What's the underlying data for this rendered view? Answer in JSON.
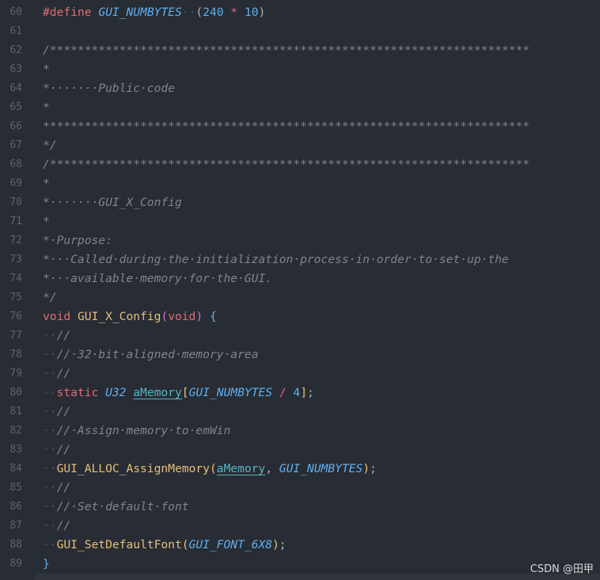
{
  "watermark": "CSDN @田甲",
  "lines": [
    {
      "n": "60",
      "parts": [
        [
          "kw",
          "#define"
        ],
        [
          "ws",
          " "
        ],
        [
          "cst",
          "GUI_NUMBYTES"
        ],
        [
          "ws",
          "··"
        ],
        [
          "code",
          "("
        ],
        [
          "num",
          "240"
        ],
        [
          "ws",
          " "
        ],
        [
          "op",
          "*"
        ],
        [
          "ws",
          " "
        ],
        [
          "num",
          "10"
        ],
        [
          "code",
          ")"
        ]
      ]
    },
    {
      "n": "61",
      "parts": []
    },
    {
      "n": "62",
      "parts": [
        [
          "cm",
          "/*********************************************************************"
        ]
      ]
    },
    {
      "n": "63",
      "parts": [
        [
          "cm",
          "*"
        ]
      ]
    },
    {
      "n": "64",
      "parts": [
        [
          "cm",
          "*·······Public·code"
        ]
      ]
    },
    {
      "n": "65",
      "parts": [
        [
          "cm",
          "*"
        ]
      ]
    },
    {
      "n": "66",
      "parts": [
        [
          "cm",
          "**********************************************************************"
        ]
      ]
    },
    {
      "n": "67",
      "parts": [
        [
          "cm",
          "*/"
        ]
      ]
    },
    {
      "n": "68",
      "parts": [
        [
          "cm",
          "/*********************************************************************"
        ]
      ]
    },
    {
      "n": "69",
      "parts": [
        [
          "cm",
          "*"
        ]
      ]
    },
    {
      "n": "70",
      "parts": [
        [
          "cm",
          "*·······GUI_X_Config"
        ]
      ]
    },
    {
      "n": "71",
      "parts": [
        [
          "cm",
          "*"
        ]
      ]
    },
    {
      "n": "72",
      "parts": [
        [
          "cm",
          "*·Purpose:"
        ]
      ]
    },
    {
      "n": "73",
      "parts": [
        [
          "cm",
          "*···Called·during·the·initialization·process·in·order·to·set·up·the"
        ]
      ]
    },
    {
      "n": "74",
      "parts": [
        [
          "cm",
          "*···available·memory·for·the·GUI."
        ]
      ]
    },
    {
      "n": "75",
      "parts": [
        [
          "cm",
          "*/"
        ]
      ]
    },
    {
      "n": "76",
      "parts": [
        [
          "kw",
          "void"
        ],
        [
          "ws",
          " "
        ],
        [
          "fn2",
          "GUI_X_Config"
        ],
        [
          "ty",
          "("
        ],
        [
          "kw",
          "void"
        ],
        [
          "ty",
          ")"
        ],
        [
          "ws",
          " "
        ],
        [
          "br",
          "{"
        ]
      ]
    },
    {
      "n": "77",
      "parts": [
        [
          "ws",
          "··"
        ],
        [
          "cm",
          "//"
        ]
      ]
    },
    {
      "n": "78",
      "parts": [
        [
          "ws",
          "··"
        ],
        [
          "cm",
          "//·32·bit·aligned·memory·area"
        ]
      ]
    },
    {
      "n": "79",
      "parts": [
        [
          "ws",
          "··"
        ],
        [
          "cm",
          "//"
        ]
      ]
    },
    {
      "n": "80",
      "parts": [
        [
          "ws",
          "··"
        ],
        [
          "kw",
          "static"
        ],
        [
          "ws",
          " "
        ],
        [
          "cst",
          "U32"
        ],
        [
          "ws",
          " "
        ],
        [
          "var",
          "aMemory"
        ],
        [
          "br2",
          "["
        ],
        [
          "cst",
          "GUI_NUMBYTES"
        ],
        [
          "ws",
          " "
        ],
        [
          "op",
          "/"
        ],
        [
          "ws",
          " "
        ],
        [
          "num",
          "4"
        ],
        [
          "br2",
          "]"
        ],
        [
          "code",
          ";"
        ]
      ]
    },
    {
      "n": "81",
      "parts": [
        [
          "ws",
          "··"
        ],
        [
          "cm",
          "//"
        ]
      ]
    },
    {
      "n": "82",
      "parts": [
        [
          "ws",
          "··"
        ],
        [
          "cm",
          "//·Assign·memory·to·emWin"
        ]
      ]
    },
    {
      "n": "83",
      "parts": [
        [
          "ws",
          "··"
        ],
        [
          "cm",
          "//"
        ]
      ]
    },
    {
      "n": "84",
      "parts": [
        [
          "ws",
          "··"
        ],
        [
          "fn2",
          "GUI_ALLOC_AssignMemory"
        ],
        [
          "br2",
          "("
        ],
        [
          "var",
          "aMemory"
        ],
        [
          "code",
          ","
        ],
        [
          "ws",
          " "
        ],
        [
          "cst",
          "GUI_NUMBYTES"
        ],
        [
          "br2",
          ")"
        ],
        [
          "code",
          ";"
        ]
      ]
    },
    {
      "n": "85",
      "parts": [
        [
          "ws",
          "··"
        ],
        [
          "cm",
          "//"
        ]
      ]
    },
    {
      "n": "86",
      "parts": [
        [
          "ws",
          "··"
        ],
        [
          "cm",
          "//·Set·default·font"
        ]
      ]
    },
    {
      "n": "87",
      "parts": [
        [
          "ws",
          "··"
        ],
        [
          "cm",
          "//"
        ]
      ]
    },
    {
      "n": "88",
      "parts": [
        [
          "ws",
          "··"
        ],
        [
          "fn2",
          "GUI_SetDefaultFont"
        ],
        [
          "br2",
          "("
        ],
        [
          "cst",
          "GUI_FONT_6X8"
        ],
        [
          "br2",
          ")"
        ],
        [
          "code",
          ";"
        ]
      ]
    },
    {
      "n": "89",
      "parts": [
        [
          "br",
          "}"
        ]
      ]
    }
  ]
}
